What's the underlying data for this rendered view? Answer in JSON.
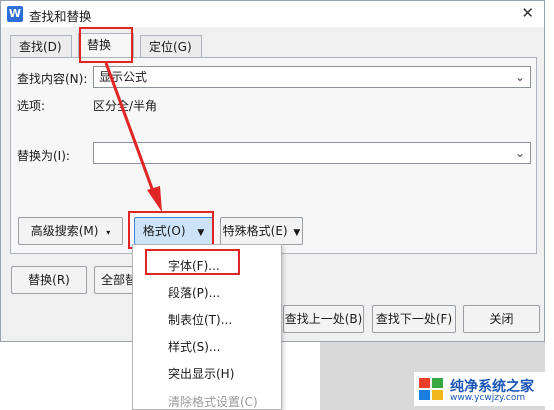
{
  "window": {
    "title": "查找和替换",
    "close_glyph": "✕"
  },
  "tabs": [
    {
      "label": "查找(D)"
    },
    {
      "label": "替换(P)"
    },
    {
      "label": "定位(G)"
    }
  ],
  "find": {
    "label": "查找内容(N):",
    "value": "显示公式"
  },
  "options": {
    "label": "选项:",
    "value": "区分全/半角"
  },
  "replace": {
    "label": "替换为(I):",
    "value": ""
  },
  "buttons": {
    "advanced_search": "高级搜索(M)",
    "advanced_glyph": "⯅⯆",
    "format": "格式(O)",
    "format_arrow": "▼",
    "special_format": "特殊格式(E)",
    "special_arrow": "▼",
    "replace": "替换(R)",
    "replace_all": "全部替",
    "find_prev": "查找上一处(B)",
    "find_next": "查找下一处(F)",
    "close": "关闭"
  },
  "format_menu": {
    "items": [
      {
        "label": "字体(F)..."
      },
      {
        "label": "段落(P)..."
      },
      {
        "label": "制表位(T)..."
      },
      {
        "label": "样式(S)..."
      },
      {
        "label": "突出显示(H)"
      },
      {
        "label": "清除格式设置(C)"
      }
    ]
  },
  "watermark": {
    "name": "纯净系统之家",
    "url": "www.ycwjzy.com"
  },
  "colors": {
    "highlight_red": "#e02525",
    "accent_blue": "#2f6ed8"
  }
}
